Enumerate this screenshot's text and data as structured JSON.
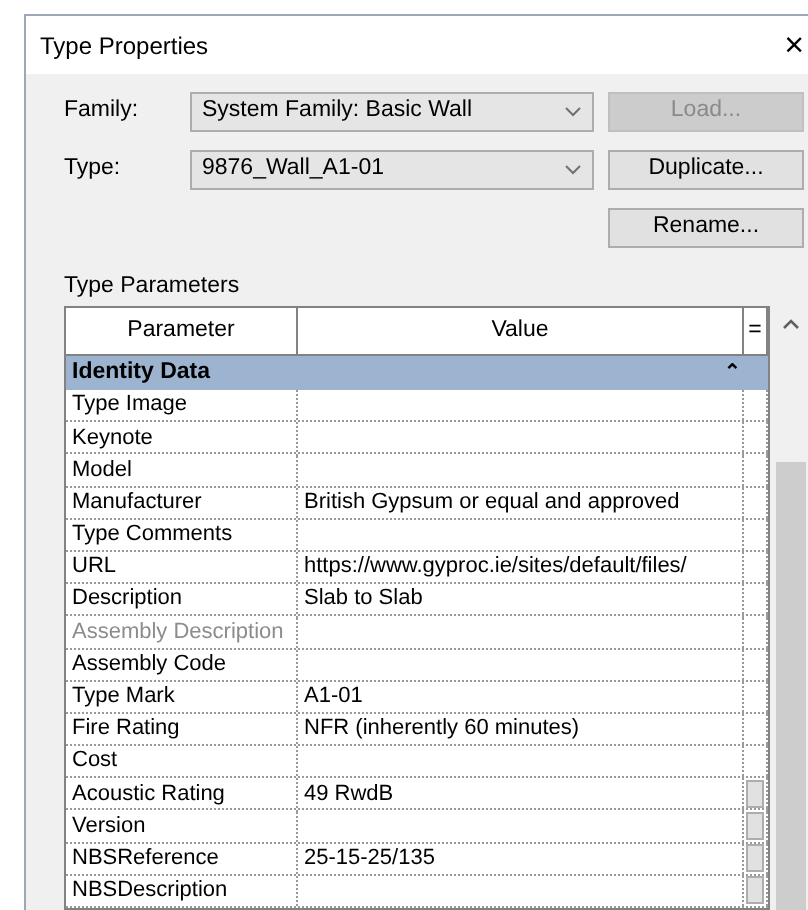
{
  "window": {
    "title": "Type Properties",
    "close": "×"
  },
  "fields": [
    {
      "label": "Family:",
      "value": "System Family: Basic Wall",
      "button": {
        "label": "Load...",
        "disabled": true
      }
    },
    {
      "label": "Type:",
      "value": "9876_Wall_A1-01",
      "button": {
        "label": "Duplicate...",
        "disabled": false
      }
    }
  ],
  "extra_button": {
    "label": "Rename...",
    "disabled": false
  },
  "section_label": "Type Parameters",
  "table": {
    "columns": [
      "Parameter",
      "Value",
      "="
    ],
    "group": {
      "title": "Identity Data",
      "collapse": "⌃"
    },
    "rows": [
      {
        "parameter": "Type Image",
        "value": "",
        "disabled": false,
        "formula_button": false
      },
      {
        "parameter": "Keynote",
        "value": "",
        "disabled": false,
        "formula_button": false
      },
      {
        "parameter": "Model",
        "value": "",
        "disabled": false,
        "formula_button": false
      },
      {
        "parameter": "Manufacturer",
        "value": "British Gypsum or equal and approved",
        "disabled": false,
        "formula_button": false
      },
      {
        "parameter": "Type Comments",
        "value": "",
        "disabled": false,
        "formula_button": false
      },
      {
        "parameter": "URL",
        "value": "https://www.gyproc.ie/sites/default/files/",
        "disabled": false,
        "formula_button": false
      },
      {
        "parameter": "Description",
        "value": "Slab to Slab",
        "disabled": false,
        "formula_button": false
      },
      {
        "parameter": "Assembly Description",
        "value": "",
        "disabled": true,
        "formula_button": false
      },
      {
        "parameter": "Assembly Code",
        "value": "",
        "disabled": false,
        "formula_button": false
      },
      {
        "parameter": "Type Mark",
        "value": "A1-01",
        "disabled": false,
        "formula_button": false
      },
      {
        "parameter": "Fire Rating",
        "value": "NFR (inherently 60 minutes)",
        "disabled": false,
        "formula_button": false
      },
      {
        "parameter": "Cost",
        "value": "",
        "disabled": false,
        "formula_button": false
      },
      {
        "parameter": "Acoustic Rating",
        "value": "49 RwdB",
        "disabled": false,
        "formula_button": true
      },
      {
        "parameter": "Version",
        "value": "",
        "disabled": false,
        "formula_button": true
      },
      {
        "parameter": "NBSReference",
        "value": "25-15-25/135",
        "disabled": false,
        "formula_button": true
      },
      {
        "parameter": "NBSDescription",
        "value": "",
        "disabled": false,
        "formula_button": true
      }
    ]
  }
}
